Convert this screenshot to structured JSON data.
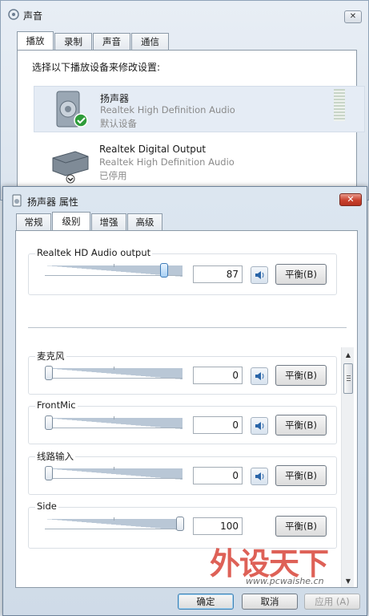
{
  "sound_window": {
    "title": "声音",
    "close": "✕",
    "tabs": [
      "播放",
      "录制",
      "声音",
      "通信"
    ],
    "prompt": "选择以下播放设备来修改设置:",
    "devices": [
      {
        "name": "扬声器",
        "driver": "Realtek High Definition Audio",
        "status": "默认设备"
      },
      {
        "name": "Realtek Digital Output",
        "driver": "Realtek High Definition Audio",
        "status": "已停用"
      }
    ]
  },
  "props_window": {
    "title": "扬声器 属性",
    "close": "✕",
    "tabs": [
      "常规",
      "级别",
      "增强",
      "高级"
    ],
    "active_tab": "级别",
    "master": {
      "label": "Realtek HD Audio output",
      "value": "87",
      "balance": "平衡(B)"
    },
    "channels": [
      {
        "label": "麦克风",
        "value": "0",
        "balance": "平衡(B)"
      },
      {
        "label": "FrontMic",
        "value": "0",
        "balance": "平衡(B)"
      },
      {
        "label": "线路输入",
        "value": "0",
        "balance": "平衡(B)"
      },
      {
        "label": "Side",
        "value": "100",
        "balance": "平衡(B)"
      }
    ],
    "buttons": {
      "ok": "确定",
      "cancel": "取消",
      "apply": "应用 (A)"
    }
  },
  "watermark": {
    "text": "外设天下",
    "url": "www.pcwaishe.cn"
  },
  "colors": {
    "close_red": "#c9412d",
    "accent_blue": "#3d7bb8",
    "status_green": "#2e9c3a"
  },
  "icons": [
    "sound-icon",
    "speaker-device-icon",
    "digital-output-device-icon",
    "default-check-icon",
    "disabled-down-icon",
    "speaker-mute-icon"
  ]
}
